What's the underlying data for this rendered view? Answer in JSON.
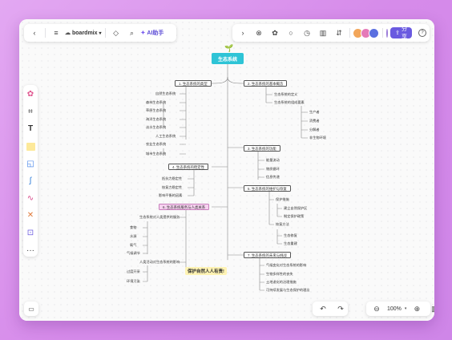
{
  "app": {
    "brand": "boardmix",
    "ai_label": "AI助手",
    "share_label": "分享",
    "zoom": "100%"
  },
  "mindmap": {
    "root": "生态系统",
    "sticker": "保护自然人人有责!",
    "branches": [
      {
        "id": "b1",
        "label": "1. 生态系统的类型",
        "children": [
          "自然生态系统",
          "森林生态系统",
          "草原生态系统",
          "海洋生态系统",
          "淡水生态系统",
          "人工生态系统",
          "农业生态系统",
          "城市生态系统"
        ]
      },
      {
        "id": "b2",
        "label": "2. 生态系统的基本概念",
        "children": [
          "生态系统的定义",
          "生态系统的组成要素",
          "生产者",
          "消费者",
          "分解者",
          "非生物环境"
        ]
      },
      {
        "id": "b3",
        "label": "3. 生态系统的功能",
        "children": [
          "能量流动",
          "物质循环",
          "信息传递"
        ]
      },
      {
        "id": "b4",
        "label": "4. 生态系统的稳定性",
        "children": [
          "抵抗力稳定性",
          "恢复力稳定性",
          "影响平衡的因素"
        ]
      },
      {
        "id": "b5",
        "label": "5. 生态系统的维护与恢复",
        "children": [
          "保护措施",
          "建立自然保护区",
          "制定保护政策",
          "恢复方法",
          "生态修复",
          "生态重建"
        ]
      },
      {
        "id": "b6",
        "label": "6. 生态系统服务与人类关系",
        "children": [
          "生态系统对人类提供的服务",
          "食物",
          "水源",
          "氧气",
          "气候调节",
          "人类活动对生态系统的影响",
          "过度开采",
          "环境污染"
        ]
      },
      {
        "id": "b7",
        "label": "7. 生态系统的未来与挑战",
        "children": [
          "气候变化对生态系统的影响",
          "生物多样性的丧失",
          "土地退化的治理措施",
          "可持续发展与生态保护的理念"
        ]
      }
    ]
  }
}
